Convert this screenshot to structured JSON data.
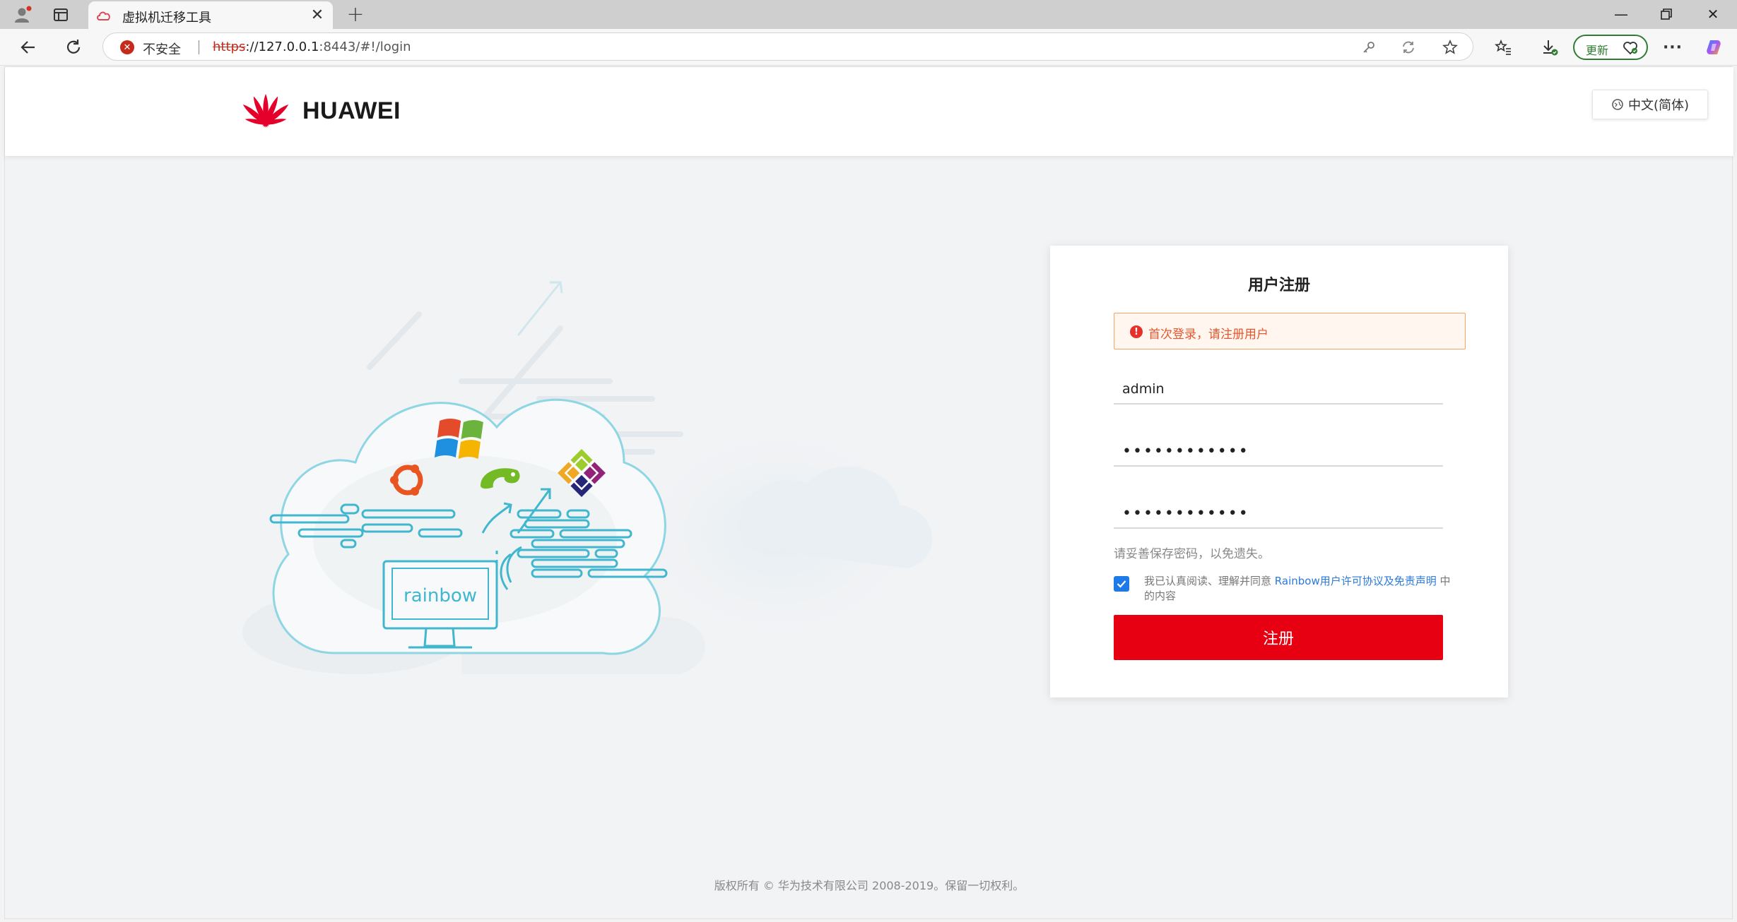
{
  "browser": {
    "tab_title": "虚拟机迁移工具",
    "security_label": "不安全",
    "url_protocol": "https",
    "url_host": "://127.0.0.1",
    "url_rest": ":8443/#!/login",
    "update_label": "更新",
    "icons": [
      "profile-icon",
      "tab-actions-icon",
      "cloud-favicon-icon",
      "close-icon",
      "plus-icon",
      "back-icon",
      "refresh-icon",
      "warning-icon",
      "key-icon",
      "sync-icon",
      "star-icon",
      "favorites-icon",
      "download-icon",
      "heart-icon",
      "more-icon",
      "copilot-icon",
      "minimize-icon",
      "restore-icon",
      "window-close-icon"
    ]
  },
  "header": {
    "logo_text": "HUAWEI",
    "language": "中文(简体)"
  },
  "illustration": {
    "monitor_text": "rainbow"
  },
  "register": {
    "title": "用户注册",
    "alert": "首次登录，请注册用户",
    "username": "admin",
    "password": "••••••••••••",
    "confirm_password": "••••••••••••",
    "hint": "请妥善保存密码，以免遗失。",
    "agreement_checked": true,
    "agree_prefix": "我已认真阅读、理解并同意 ",
    "agree_link": "Rainbow用户许可协议及免责声明",
    "agree_suffix": " 中的内容",
    "submit_label": "注册"
  },
  "footer": {
    "copyright": "版权所有 © 华为技术有限公司 2008-2019。保留一切权利。"
  },
  "colors": {
    "brand_red": "#e60012",
    "link_blue": "#2a7ad8",
    "alert_orange": "#e8562b",
    "update_green": "#2e7d32"
  }
}
